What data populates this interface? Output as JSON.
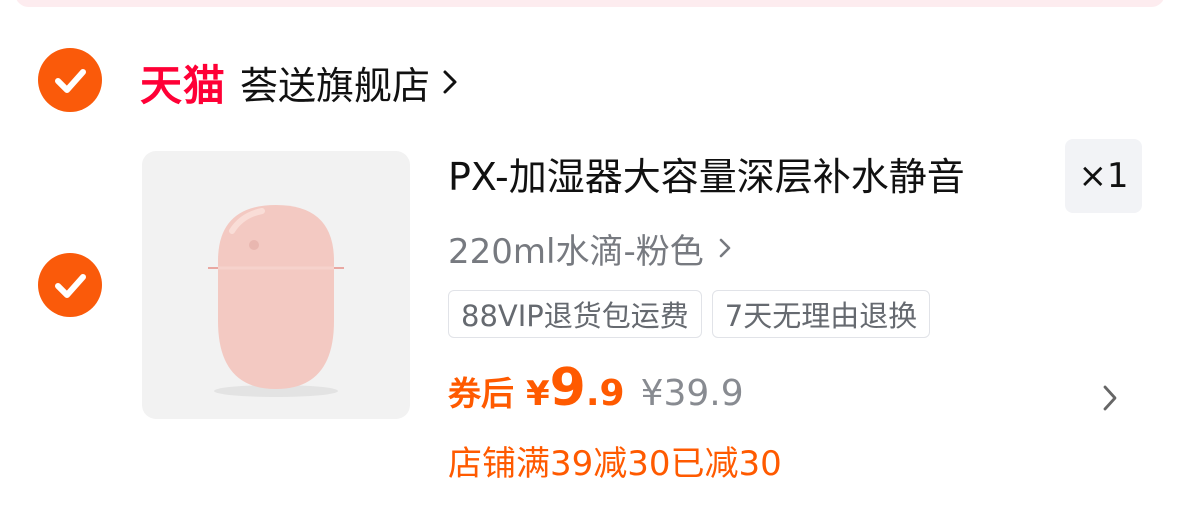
{
  "shop": {
    "platform_label": "天猫",
    "name": "荟送旗舰店"
  },
  "item": {
    "title": "PX-加湿器大容量深层补水静音",
    "quantity": "×1",
    "variant": "220ml水滴-粉色",
    "tags": [
      "88VIP退货包运费",
      "7天无理由退换"
    ],
    "price_prefix": "券后",
    "currency": "¥",
    "price_int": "9",
    "price_dec": ".9",
    "original_price": "¥39.9",
    "promo_text": "店铺满39减30已减30"
  },
  "colors": {
    "accent": "#fa5a0a",
    "tmall_red": "#ff0036",
    "price_orange": "#ff5a00"
  },
  "icons": {
    "check": "checkmark-icon",
    "chevron": "chevron-right-icon"
  }
}
